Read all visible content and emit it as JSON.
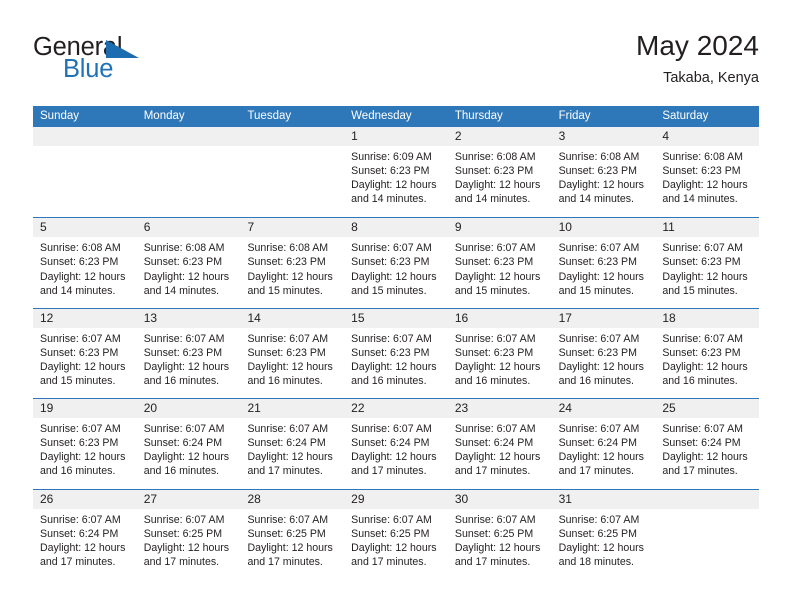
{
  "brand": {
    "name_part1": "General",
    "name_part2": "Blue",
    "flag_icon": "blue-flag-triangle"
  },
  "header": {
    "title": "May 2024",
    "subtitle": "Takaba, Kenya"
  },
  "colors": {
    "header_blue": "#2e77b8",
    "daynum_gray": "#f0f0f0",
    "brand_blue": "#1f72b8",
    "text": "#231f20"
  },
  "weekday_headers": [
    "Sunday",
    "Monday",
    "Tuesday",
    "Wednesday",
    "Thursday",
    "Friday",
    "Saturday"
  ],
  "weeks": [
    [
      {
        "day": "",
        "blank": true,
        "sunrise": "",
        "sunset": "",
        "daylight_line1": "",
        "daylight_line2": ""
      },
      {
        "day": "",
        "blank": true,
        "sunrise": "",
        "sunset": "",
        "daylight_line1": "",
        "daylight_line2": ""
      },
      {
        "day": "",
        "blank": true,
        "sunrise": "",
        "sunset": "",
        "daylight_line1": "",
        "daylight_line2": ""
      },
      {
        "day": "1",
        "blank": false,
        "sunrise": "Sunrise: 6:09 AM",
        "sunset": "Sunset: 6:23 PM",
        "daylight_line1": "Daylight: 12 hours",
        "daylight_line2": "and 14 minutes."
      },
      {
        "day": "2",
        "blank": false,
        "sunrise": "Sunrise: 6:08 AM",
        "sunset": "Sunset: 6:23 PM",
        "daylight_line1": "Daylight: 12 hours",
        "daylight_line2": "and 14 minutes."
      },
      {
        "day": "3",
        "blank": false,
        "sunrise": "Sunrise: 6:08 AM",
        "sunset": "Sunset: 6:23 PM",
        "daylight_line1": "Daylight: 12 hours",
        "daylight_line2": "and 14 minutes."
      },
      {
        "day": "4",
        "blank": false,
        "sunrise": "Sunrise: 6:08 AM",
        "sunset": "Sunset: 6:23 PM",
        "daylight_line1": "Daylight: 12 hours",
        "daylight_line2": "and 14 minutes."
      }
    ],
    [
      {
        "day": "5",
        "blank": false,
        "sunrise": "Sunrise: 6:08 AM",
        "sunset": "Sunset: 6:23 PM",
        "daylight_line1": "Daylight: 12 hours",
        "daylight_line2": "and 14 minutes."
      },
      {
        "day": "6",
        "blank": false,
        "sunrise": "Sunrise: 6:08 AM",
        "sunset": "Sunset: 6:23 PM",
        "daylight_line1": "Daylight: 12 hours",
        "daylight_line2": "and 14 minutes."
      },
      {
        "day": "7",
        "blank": false,
        "sunrise": "Sunrise: 6:08 AM",
        "sunset": "Sunset: 6:23 PM",
        "daylight_line1": "Daylight: 12 hours",
        "daylight_line2": "and 15 minutes."
      },
      {
        "day": "8",
        "blank": false,
        "sunrise": "Sunrise: 6:07 AM",
        "sunset": "Sunset: 6:23 PM",
        "daylight_line1": "Daylight: 12 hours",
        "daylight_line2": "and 15 minutes."
      },
      {
        "day": "9",
        "blank": false,
        "sunrise": "Sunrise: 6:07 AM",
        "sunset": "Sunset: 6:23 PM",
        "daylight_line1": "Daylight: 12 hours",
        "daylight_line2": "and 15 minutes."
      },
      {
        "day": "10",
        "blank": false,
        "sunrise": "Sunrise: 6:07 AM",
        "sunset": "Sunset: 6:23 PM",
        "daylight_line1": "Daylight: 12 hours",
        "daylight_line2": "and 15 minutes."
      },
      {
        "day": "11",
        "blank": false,
        "sunrise": "Sunrise: 6:07 AM",
        "sunset": "Sunset: 6:23 PM",
        "daylight_line1": "Daylight: 12 hours",
        "daylight_line2": "and 15 minutes."
      }
    ],
    [
      {
        "day": "12",
        "blank": false,
        "sunrise": "Sunrise: 6:07 AM",
        "sunset": "Sunset: 6:23 PM",
        "daylight_line1": "Daylight: 12 hours",
        "daylight_line2": "and 15 minutes."
      },
      {
        "day": "13",
        "blank": false,
        "sunrise": "Sunrise: 6:07 AM",
        "sunset": "Sunset: 6:23 PM",
        "daylight_line1": "Daylight: 12 hours",
        "daylight_line2": "and 16 minutes."
      },
      {
        "day": "14",
        "blank": false,
        "sunrise": "Sunrise: 6:07 AM",
        "sunset": "Sunset: 6:23 PM",
        "daylight_line1": "Daylight: 12 hours",
        "daylight_line2": "and 16 minutes."
      },
      {
        "day": "15",
        "blank": false,
        "sunrise": "Sunrise: 6:07 AM",
        "sunset": "Sunset: 6:23 PM",
        "daylight_line1": "Daylight: 12 hours",
        "daylight_line2": "and 16 minutes."
      },
      {
        "day": "16",
        "blank": false,
        "sunrise": "Sunrise: 6:07 AM",
        "sunset": "Sunset: 6:23 PM",
        "daylight_line1": "Daylight: 12 hours",
        "daylight_line2": "and 16 minutes."
      },
      {
        "day": "17",
        "blank": false,
        "sunrise": "Sunrise: 6:07 AM",
        "sunset": "Sunset: 6:23 PM",
        "daylight_line1": "Daylight: 12 hours",
        "daylight_line2": "and 16 minutes."
      },
      {
        "day": "18",
        "blank": false,
        "sunrise": "Sunrise: 6:07 AM",
        "sunset": "Sunset: 6:23 PM",
        "daylight_line1": "Daylight: 12 hours",
        "daylight_line2": "and 16 minutes."
      }
    ],
    [
      {
        "day": "19",
        "blank": false,
        "sunrise": "Sunrise: 6:07 AM",
        "sunset": "Sunset: 6:23 PM",
        "daylight_line1": "Daylight: 12 hours",
        "daylight_line2": "and 16 minutes."
      },
      {
        "day": "20",
        "blank": false,
        "sunrise": "Sunrise: 6:07 AM",
        "sunset": "Sunset: 6:24 PM",
        "daylight_line1": "Daylight: 12 hours",
        "daylight_line2": "and 16 minutes."
      },
      {
        "day": "21",
        "blank": false,
        "sunrise": "Sunrise: 6:07 AM",
        "sunset": "Sunset: 6:24 PM",
        "daylight_line1": "Daylight: 12 hours",
        "daylight_line2": "and 17 minutes."
      },
      {
        "day": "22",
        "blank": false,
        "sunrise": "Sunrise: 6:07 AM",
        "sunset": "Sunset: 6:24 PM",
        "daylight_line1": "Daylight: 12 hours",
        "daylight_line2": "and 17 minutes."
      },
      {
        "day": "23",
        "blank": false,
        "sunrise": "Sunrise: 6:07 AM",
        "sunset": "Sunset: 6:24 PM",
        "daylight_line1": "Daylight: 12 hours",
        "daylight_line2": "and 17 minutes."
      },
      {
        "day": "24",
        "blank": false,
        "sunrise": "Sunrise: 6:07 AM",
        "sunset": "Sunset: 6:24 PM",
        "daylight_line1": "Daylight: 12 hours",
        "daylight_line2": "and 17 minutes."
      },
      {
        "day": "25",
        "blank": false,
        "sunrise": "Sunrise: 6:07 AM",
        "sunset": "Sunset: 6:24 PM",
        "daylight_line1": "Daylight: 12 hours",
        "daylight_line2": "and 17 minutes."
      }
    ],
    [
      {
        "day": "26",
        "blank": false,
        "sunrise": "Sunrise: 6:07 AM",
        "sunset": "Sunset: 6:24 PM",
        "daylight_line1": "Daylight: 12 hours",
        "daylight_line2": "and 17 minutes."
      },
      {
        "day": "27",
        "blank": false,
        "sunrise": "Sunrise: 6:07 AM",
        "sunset": "Sunset: 6:25 PM",
        "daylight_line1": "Daylight: 12 hours",
        "daylight_line2": "and 17 minutes."
      },
      {
        "day": "28",
        "blank": false,
        "sunrise": "Sunrise: 6:07 AM",
        "sunset": "Sunset: 6:25 PM",
        "daylight_line1": "Daylight: 12 hours",
        "daylight_line2": "and 17 minutes."
      },
      {
        "day": "29",
        "blank": false,
        "sunrise": "Sunrise: 6:07 AM",
        "sunset": "Sunset: 6:25 PM",
        "daylight_line1": "Daylight: 12 hours",
        "daylight_line2": "and 17 minutes."
      },
      {
        "day": "30",
        "blank": false,
        "sunrise": "Sunrise: 6:07 AM",
        "sunset": "Sunset: 6:25 PM",
        "daylight_line1": "Daylight: 12 hours",
        "daylight_line2": "and 17 minutes."
      },
      {
        "day": "31",
        "blank": false,
        "sunrise": "Sunrise: 6:07 AM",
        "sunset": "Sunset: 6:25 PM",
        "daylight_line1": "Daylight: 12 hours",
        "daylight_line2": "and 18 minutes."
      },
      {
        "day": "",
        "blank": true,
        "sunrise": "",
        "sunset": "",
        "daylight_line1": "",
        "daylight_line2": ""
      }
    ]
  ]
}
